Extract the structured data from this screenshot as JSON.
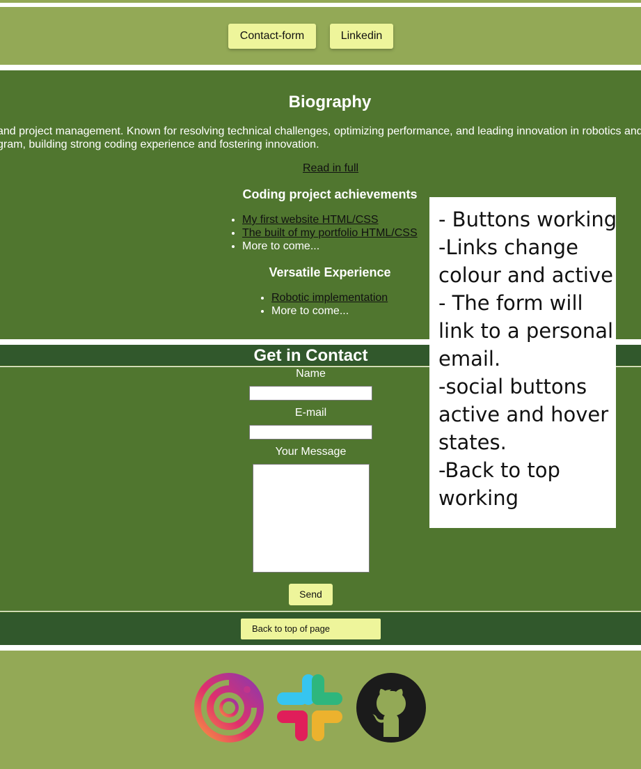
{
  "nav": {
    "contact_label": "Contact-form",
    "linkedin_label": "Linkedin"
  },
  "biography": {
    "title": "Biography",
    "text_line1": "and project management. Known for resolving technical challenges, optimizing performance, and leading innovation in robotics and",
    "text_line2": "gram, building strong coding experience and fostering innovation.",
    "read_full": "Read in full",
    "coding_heading": "Coding project achievements",
    "coding_items": [
      "My first website HTML/CSS",
      "The built of my portfolio HTML/CSS",
      "More to come..."
    ],
    "versatile_heading": "Versatile Experience",
    "versatile_items": [
      "Robotic implementation",
      "More to come..."
    ]
  },
  "contact": {
    "title": "Get in Contact",
    "name_label": "Name",
    "email_label": "E-mail",
    "message_label": "Your Message",
    "send_label": "Send",
    "back_to_top": "Back to top of page"
  },
  "social": {
    "icons": [
      "instagram-icon",
      "slack-icon",
      "github-icon"
    ]
  },
  "note": {
    "lines": [
      "- Buttons working",
      "-Links change",
      "colour and active",
      "- The form will",
      "link to a personal",
      "email.",
      "-social buttons",
      "active and hover",
      "states.",
      "-Back to top",
      "working"
    ]
  },
  "colors": {
    "light_green": "#93a956",
    "mid_green": "#50762f",
    "dark_green": "#31582c",
    "button_yellow": "#eef59b"
  }
}
